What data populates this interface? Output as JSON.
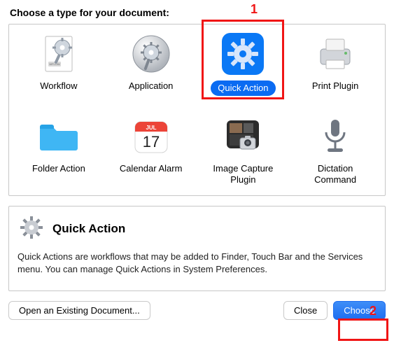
{
  "prompt": "Choose a type for your document:",
  "types": [
    {
      "id": "workflow",
      "label": "Workflow"
    },
    {
      "id": "application",
      "label": "Application"
    },
    {
      "id": "quick-action",
      "label": "Quick Action",
      "selected": true
    },
    {
      "id": "print-plugin",
      "label": "Print Plugin"
    },
    {
      "id": "folder-action",
      "label": "Folder Action"
    },
    {
      "id": "calendar-alarm",
      "label": "Calendar Alarm"
    },
    {
      "id": "image-capture",
      "label": "Image Capture Plugin"
    },
    {
      "id": "dictation",
      "label": "Dictation Command"
    }
  ],
  "calendar": {
    "month": "JUL",
    "day": "17"
  },
  "workflow_badge": "WFLOW",
  "description": {
    "title": "Quick Action",
    "body": "Quick Actions are workflows that may be added to Finder, Touch Bar and the Services menu. You can manage Quick Actions in System Preferences."
  },
  "buttons": {
    "open_existing": "Open an Existing Document...",
    "close": "Close",
    "choose": "Choose"
  },
  "annotations": {
    "one": "1",
    "two": "2"
  },
  "colors": {
    "accent": "#0a6bf2",
    "highlight": "#f01515"
  }
}
